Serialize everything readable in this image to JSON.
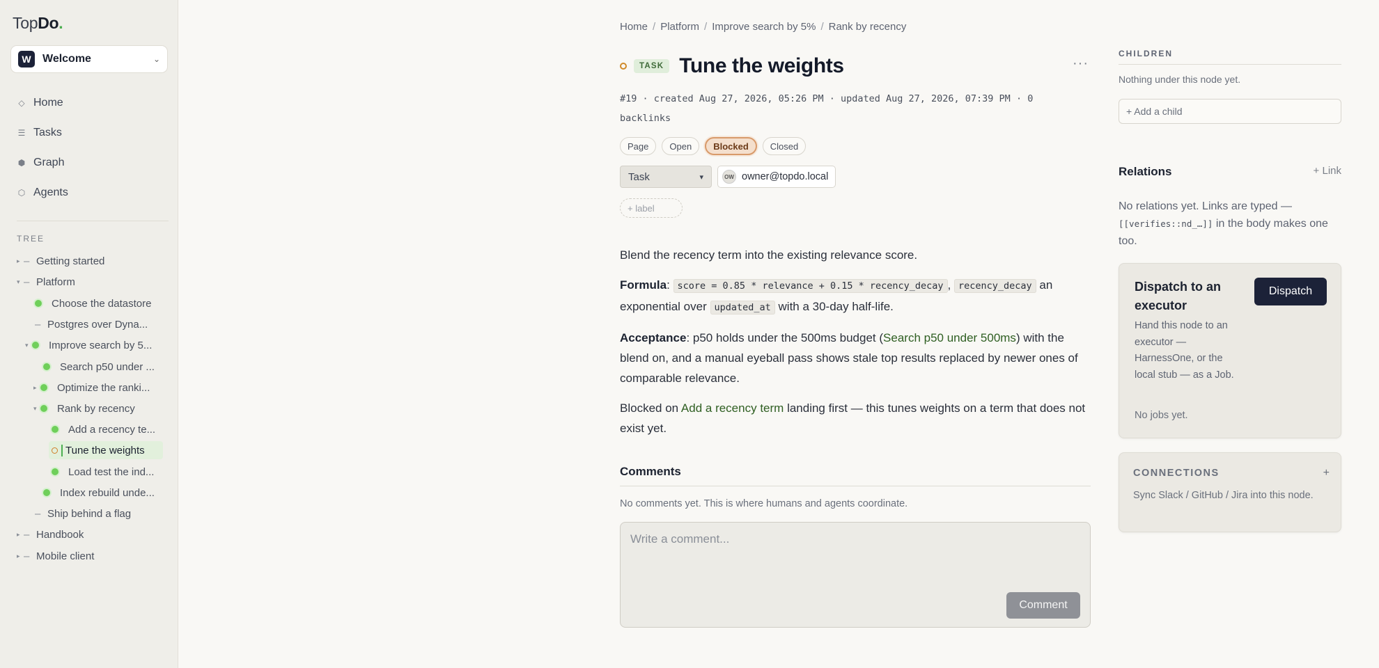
{
  "app": {
    "logo_light": "Top",
    "logo_bold": "Do",
    "logo_dot": "."
  },
  "workspace": {
    "avatar": "W",
    "name": "Welcome"
  },
  "nav": [
    {
      "icon": "◇",
      "label": "Home"
    },
    {
      "icon": "☰",
      "label": "Tasks"
    },
    {
      "icon": "⬢",
      "label": "Graph"
    },
    {
      "icon": "⬡",
      "label": "Agents"
    }
  ],
  "tree": {
    "heading": "TREE",
    "items": [
      {
        "label": "Getting started"
      },
      {
        "label": "Platform"
      },
      {
        "label": "Choose the datastore"
      },
      {
        "label": "Postgres over Dyna..."
      },
      {
        "label": "Improve search by 5..."
      },
      {
        "label": "Search p50 under ..."
      },
      {
        "label": "Optimize the ranki..."
      },
      {
        "label": "Rank by recency"
      },
      {
        "label": "Add a recency te..."
      },
      {
        "label": "Tune the weights"
      },
      {
        "label": "Load test the ind..."
      },
      {
        "label": "Index rebuild unde..."
      },
      {
        "label": "Ship behind a flag"
      },
      {
        "label": "Handbook"
      },
      {
        "label": "Mobile client"
      }
    ]
  },
  "breadcrumb": [
    "Home",
    "Platform",
    "Improve search by 5%",
    "Rank by recency"
  ],
  "node": {
    "type_badge": "TASK",
    "title": "Tune the weights",
    "more": "···",
    "meta": "#19 · created Aug 27, 2026, 05:26 PM · updated Aug 27, 2026, 07:39 PM · 0 backlinks",
    "statuses": [
      "Page",
      "Open",
      "Blocked",
      "Closed"
    ],
    "active_status": "Blocked",
    "type_select": "Task",
    "owner_initials": "OW",
    "owner": "owner@topdo.local",
    "add_label": "+ label"
  },
  "body": {
    "p1": "Blend the recency term into the existing relevance score.",
    "p2_label": "Formula",
    "p2_colon": ":",
    "p2_code1": "score = 0.85 * relevance + 0.15 * recency_decay",
    "p2_comma": ",",
    "p2_code2": "recency_decay",
    "p2_mid": "an exponential over",
    "p2_code3": "updated_at",
    "p2_end": "with a 30-day half-life.",
    "p3_label": "Acceptance",
    "p3_a": ": p50 holds under the 500ms budget (",
    "p3_link": "Search p50 under 500ms",
    "p3_b": ") with the blend on, and a manual eyeball pass shows stale top results replaced by newer ones of comparable relevance.",
    "p4_a": "Blocked on",
    "p4_link": "Add a recency term",
    "p4_b": "landing first — this tunes weights on a term that does not exist yet."
  },
  "comments": {
    "heading": "Comments",
    "empty": "No comments yet. This is where humans and agents coordinate.",
    "placeholder": "Write a comment...",
    "button": "Comment"
  },
  "children": {
    "heading": "CHILDREN",
    "empty": "Nothing under this node yet.",
    "add": "+ Add a child"
  },
  "relations": {
    "heading": "Relations",
    "link": "+ Link",
    "text_a": "No relations yet. Links are typed —",
    "code": "[[verifies::nd_…]]",
    "text_b": "in the body makes one too."
  },
  "dispatch": {
    "title": "Dispatch to an executor",
    "button": "Dispatch",
    "desc": "Hand this node to an executor — HarnessOne, or the local stub — as a Job.",
    "jobs": "No jobs yet."
  },
  "connections": {
    "heading": "CONNECTIONS",
    "plus": "+",
    "desc": "Sync Slack / GitHub / Jira into this node."
  },
  "colors": {
    "accent_dark": "#1c2238",
    "status_blocked": "#d89a6a",
    "tree_dot": "#6fcf5a"
  }
}
